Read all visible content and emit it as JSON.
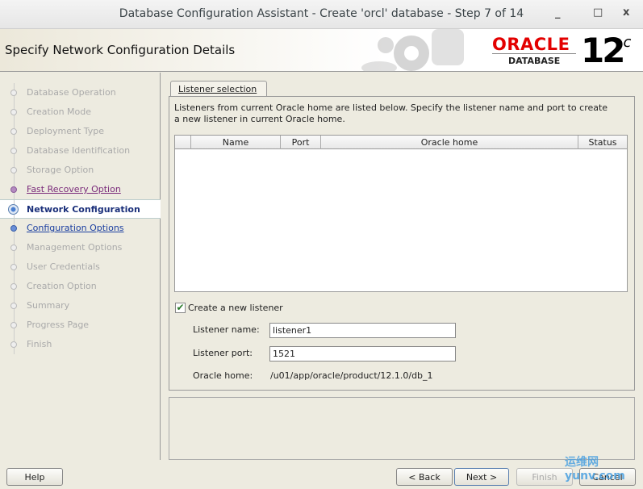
{
  "window": {
    "title": "Database Configuration Assistant - Create 'orcl' database - Step 7 of 14",
    "minimize": "_",
    "maximize": "□",
    "close": "x"
  },
  "header": {
    "title": "Specify Network Configuration Details",
    "logo_oracle": "ORACLE",
    "logo_database": "DATABASE",
    "logo_version": "12",
    "logo_suffix": "c"
  },
  "steps": [
    {
      "label": "Database Operation",
      "state": "done"
    },
    {
      "label": "Creation Mode",
      "state": "done"
    },
    {
      "label": "Deployment Type",
      "state": "done"
    },
    {
      "label": "Database Identification",
      "state": "done"
    },
    {
      "label": "Storage Option",
      "state": "done"
    },
    {
      "label": "Fast Recovery Option",
      "state": "visited"
    },
    {
      "label": "Network Configuration",
      "state": "current"
    },
    {
      "label": "Configuration Options",
      "state": "link"
    },
    {
      "label": "Management Options",
      "state": "pending"
    },
    {
      "label": "User Credentials",
      "state": "pending"
    },
    {
      "label": "Creation Option",
      "state": "pending"
    },
    {
      "label": "Summary",
      "state": "pending"
    },
    {
      "label": "Progress Page",
      "state": "pending"
    },
    {
      "label": "Finish",
      "state": "pending"
    }
  ],
  "tab": {
    "label": "Listener selection"
  },
  "content": {
    "description": "Listeners from current Oracle home are listed below. Specify the listener name and port to create a new listener in current Oracle home.",
    "table": {
      "columns": [
        "",
        "Name",
        "Port",
        "Oracle home",
        "Status"
      ],
      "rows": []
    },
    "create_listener": {
      "label": "Create a new listener",
      "checked": true
    },
    "listener_name_label": "Listener name:",
    "listener_name_value": "listener1",
    "listener_port_label": "Listener port:",
    "listener_port_value": "1521",
    "oracle_home_label": "Oracle home:",
    "oracle_home_value": "/u01/app/oracle/product/12.1.0/db_1"
  },
  "buttons": {
    "help": "Help",
    "back": "< Back",
    "next": "Next >",
    "finish": "Finish",
    "cancel": "Cancel"
  },
  "watermark": "运维网 yunv.com"
}
